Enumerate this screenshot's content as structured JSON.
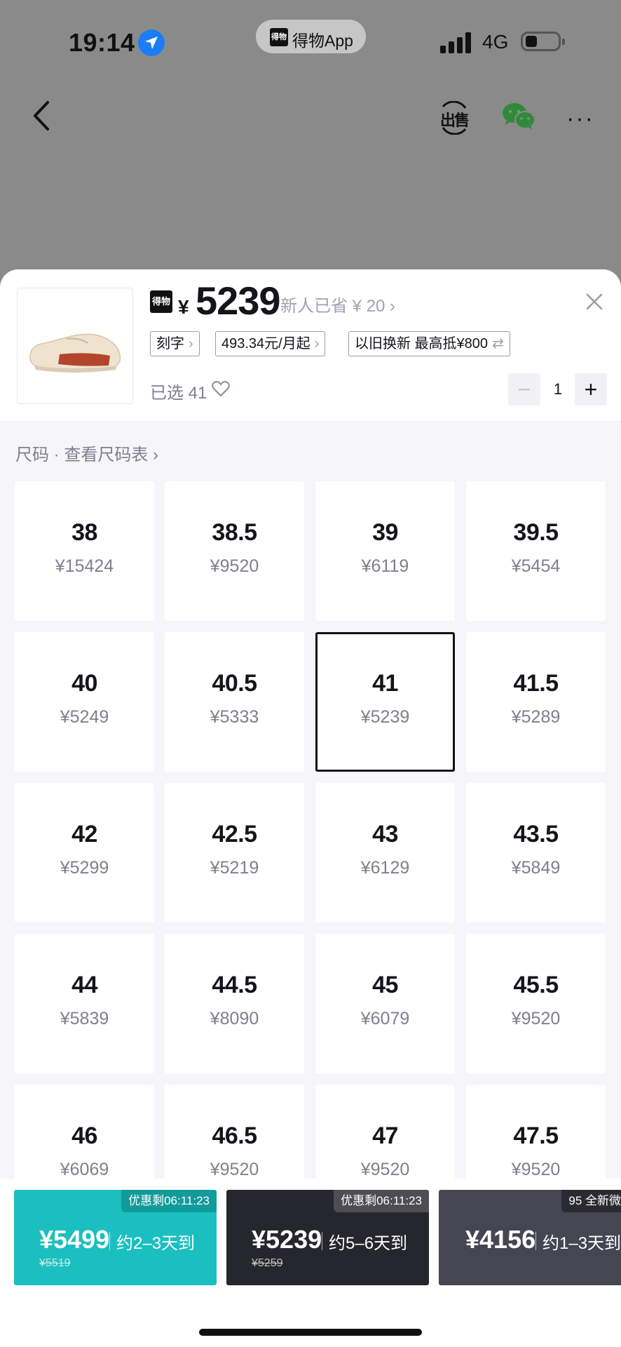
{
  "status_bar": {
    "time": "19:14",
    "app_pill": "得物App",
    "app_logo": "得物",
    "network": "4G"
  },
  "nav": {
    "sell_label": "出售",
    "more_label": "···"
  },
  "product": {
    "logo_text": "得物",
    "currency": "¥",
    "price": "5239",
    "discount_text": "新人已省 ¥ 20 ›",
    "tags": [
      {
        "label": "刻字",
        "arrow": "›"
      },
      {
        "label": "493.34元/月起",
        "arrow": "›"
      },
      {
        "label": "以旧换新 最高抵¥800",
        "arrow": "⇄"
      }
    ],
    "selected_text": "已选 41",
    "quantity": "1"
  },
  "size_section": {
    "label": "尺码 · 查看尺码表 ›"
  },
  "sizes": [
    {
      "size": "38",
      "price": "¥15424"
    },
    {
      "size": "38.5",
      "price": "¥9520"
    },
    {
      "size": "39",
      "price": "¥6119"
    },
    {
      "size": "39.5",
      "price": "¥5454"
    },
    {
      "size": "40",
      "price": "¥5249"
    },
    {
      "size": "40.5",
      "price": "¥5333"
    },
    {
      "size": "41",
      "price": "¥5239",
      "selected": true
    },
    {
      "size": "41.5",
      "price": "¥5289"
    },
    {
      "size": "42",
      "price": "¥5299"
    },
    {
      "size": "42.5",
      "price": "¥5219"
    },
    {
      "size": "43",
      "price": "¥6129"
    },
    {
      "size": "43.5",
      "price": "¥5849"
    },
    {
      "size": "44",
      "price": "¥5839"
    },
    {
      "size": "44.5",
      "price": "¥8090"
    },
    {
      "size": "45",
      "price": "¥6079"
    },
    {
      "size": "45.5",
      "price": "¥9520"
    },
    {
      "size": "46",
      "price": "¥6069"
    },
    {
      "size": "46.5",
      "price": "¥9520"
    },
    {
      "size": "47",
      "price": "¥9520"
    },
    {
      "size": "47.5",
      "price": "¥9520"
    }
  ],
  "buy_options": [
    {
      "badge": "优惠剩06:11:23",
      "price": "¥5499",
      "eta": "约2–3天到",
      "original": "¥5519",
      "color": "#1cbfbf"
    },
    {
      "badge": "优惠剩06:11:23",
      "price": "¥5239",
      "eta": "约5–6天到",
      "original": "¥5259",
      "color": "#26262e"
    },
    {
      "badge": "95 全新微",
      "price": "¥4156",
      "eta": "约1–3天到",
      "original": "",
      "color": "#454652"
    }
  ]
}
